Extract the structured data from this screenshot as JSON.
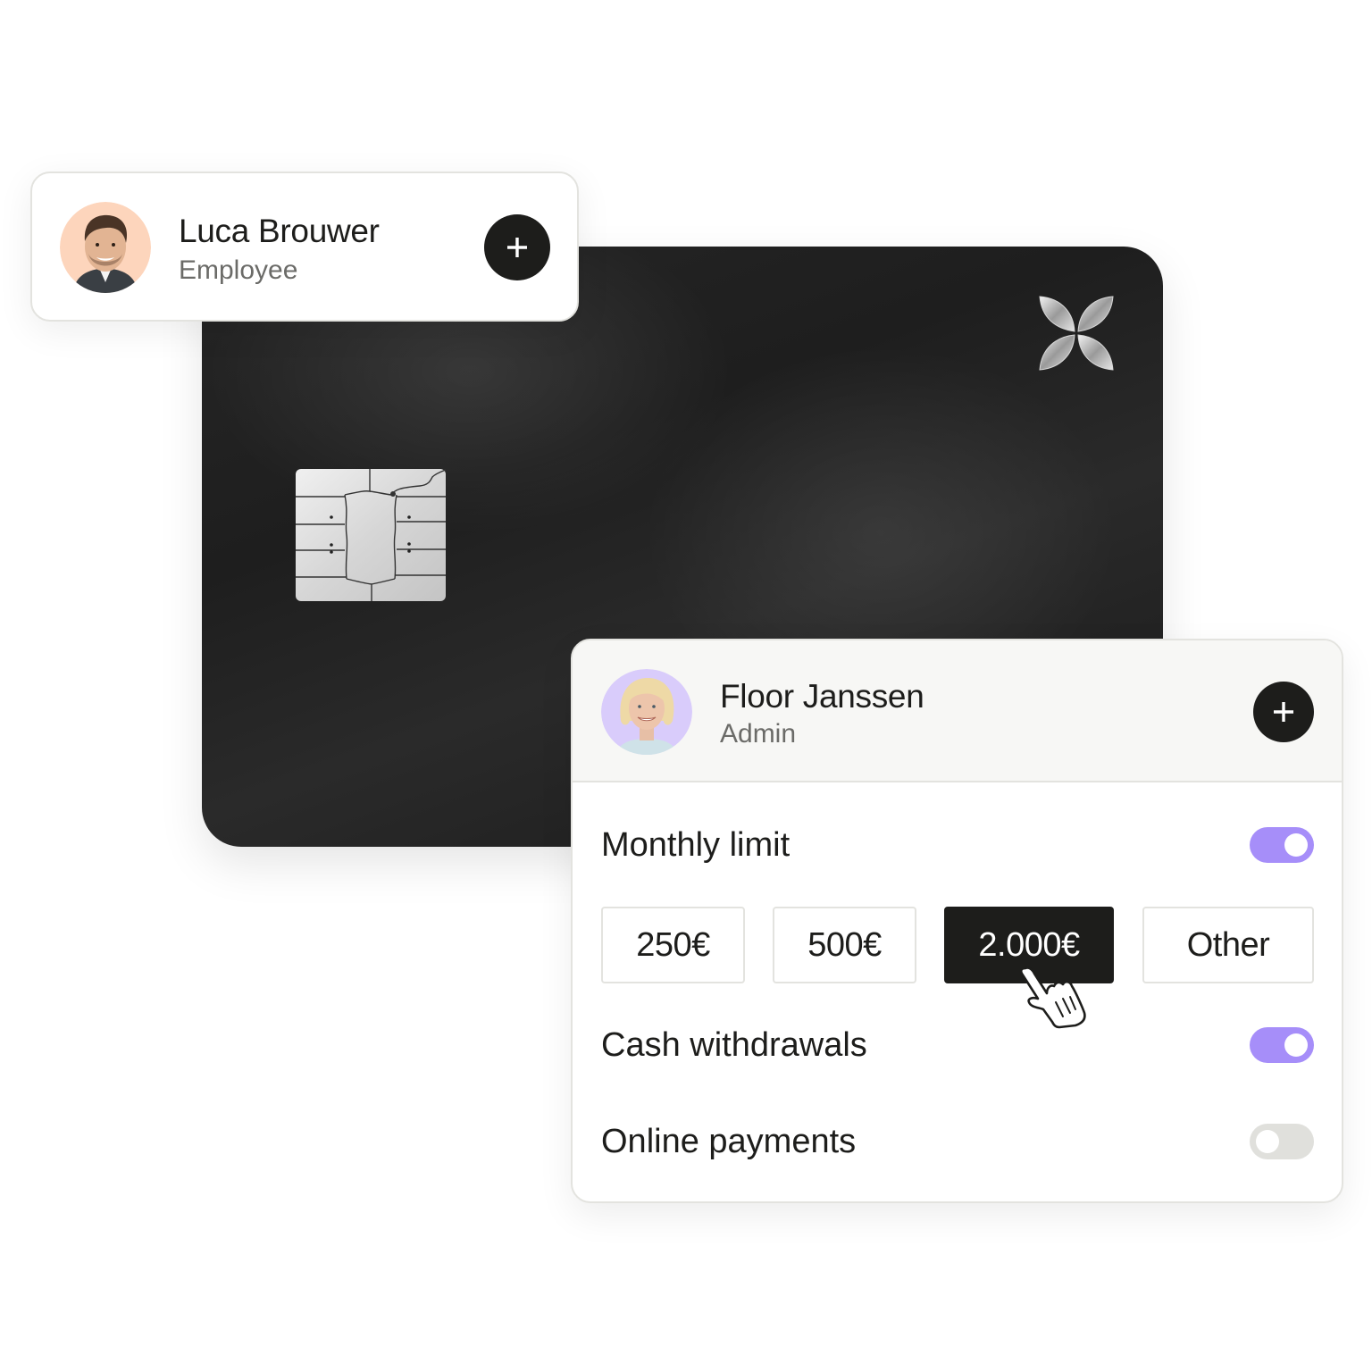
{
  "card": {
    "brand_icon": "four-petal-logo-icon",
    "chip_icon": "emv-chip-icon"
  },
  "employee_card": {
    "name": "Luca Brouwer",
    "role": "Employee",
    "avatar_bg": "#fdd5bc",
    "add_icon": "plus-icon"
  },
  "admin_panel": {
    "name": "Floor Janssen",
    "role": "Admin",
    "avatar_bg": "#d9ccfb",
    "add_icon": "plus-icon",
    "settings": [
      {
        "label": "Monthly limit",
        "enabled": true
      },
      {
        "label": "Cash withdrawals",
        "enabled": true
      },
      {
        "label": "Online payments",
        "enabled": false
      }
    ],
    "limit_options": [
      {
        "label": "250€",
        "selected": false
      },
      {
        "label": "500€",
        "selected": false
      },
      {
        "label": "2.000€",
        "selected": true
      },
      {
        "label": "Other",
        "selected": false
      }
    ]
  },
  "colors": {
    "toggle_on": "#a68ef9",
    "toggle_off": "#e0e0dc",
    "dark": "#1d1d1b",
    "panel_border": "#e3e3df"
  },
  "pointer_icon": "hand-pointer-icon"
}
